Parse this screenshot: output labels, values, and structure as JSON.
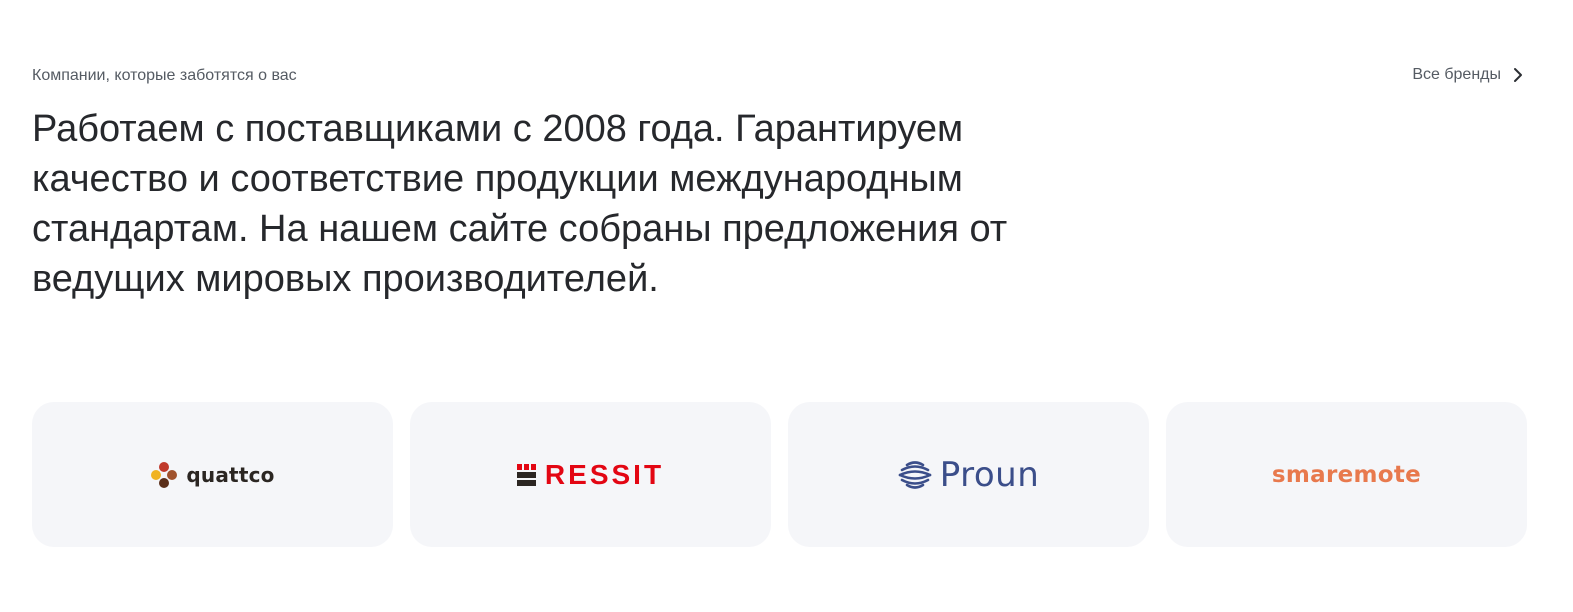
{
  "section": {
    "eyebrow": "Компании, которые заботятся о вас",
    "all_brands_label": "Все бренды",
    "headline": "Работаем с поставщиками с 2008 года. Гарантируем качество и соответствие продукции международным стандартам. На нашем сайте собраны предложения от ведущих мировых производителей."
  },
  "brands": [
    {
      "name": "quattco",
      "color": "#2b2622"
    },
    {
      "name": "RESSIT",
      "color": "#e30613"
    },
    {
      "name": "Proun",
      "color": "#3b4e8a"
    },
    {
      "name": "smaremote",
      "color": "#e8794d"
    }
  ],
  "icons": {
    "all_brands": "chevron-right-icon"
  }
}
